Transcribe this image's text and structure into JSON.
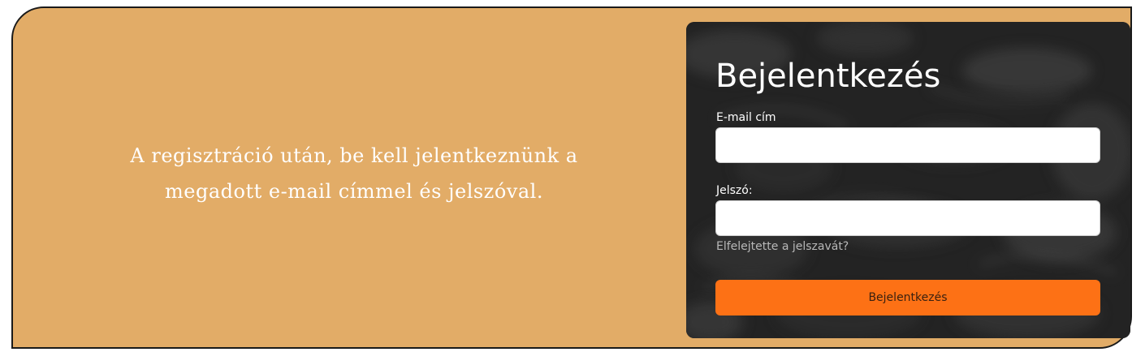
{
  "info": {
    "line1": "A regisztráció után, be kell jelentkeznünk a",
    "line2": "megadott e-mail címmel és jelszóval."
  },
  "login": {
    "title": "Bejelentkezés",
    "email_label": "E-mail cím",
    "email_value": "",
    "password_label": "Jelszó:",
    "password_value": "",
    "forgot_link": "Elfelejtette a jelszavát?",
    "submit_label": "Bejelentkezés"
  },
  "colors": {
    "frame_background": "#e2ac67",
    "panel_background": "#2a2a2a",
    "submit_button": "#fd7115",
    "forgot_link": "#b8b8b8"
  }
}
